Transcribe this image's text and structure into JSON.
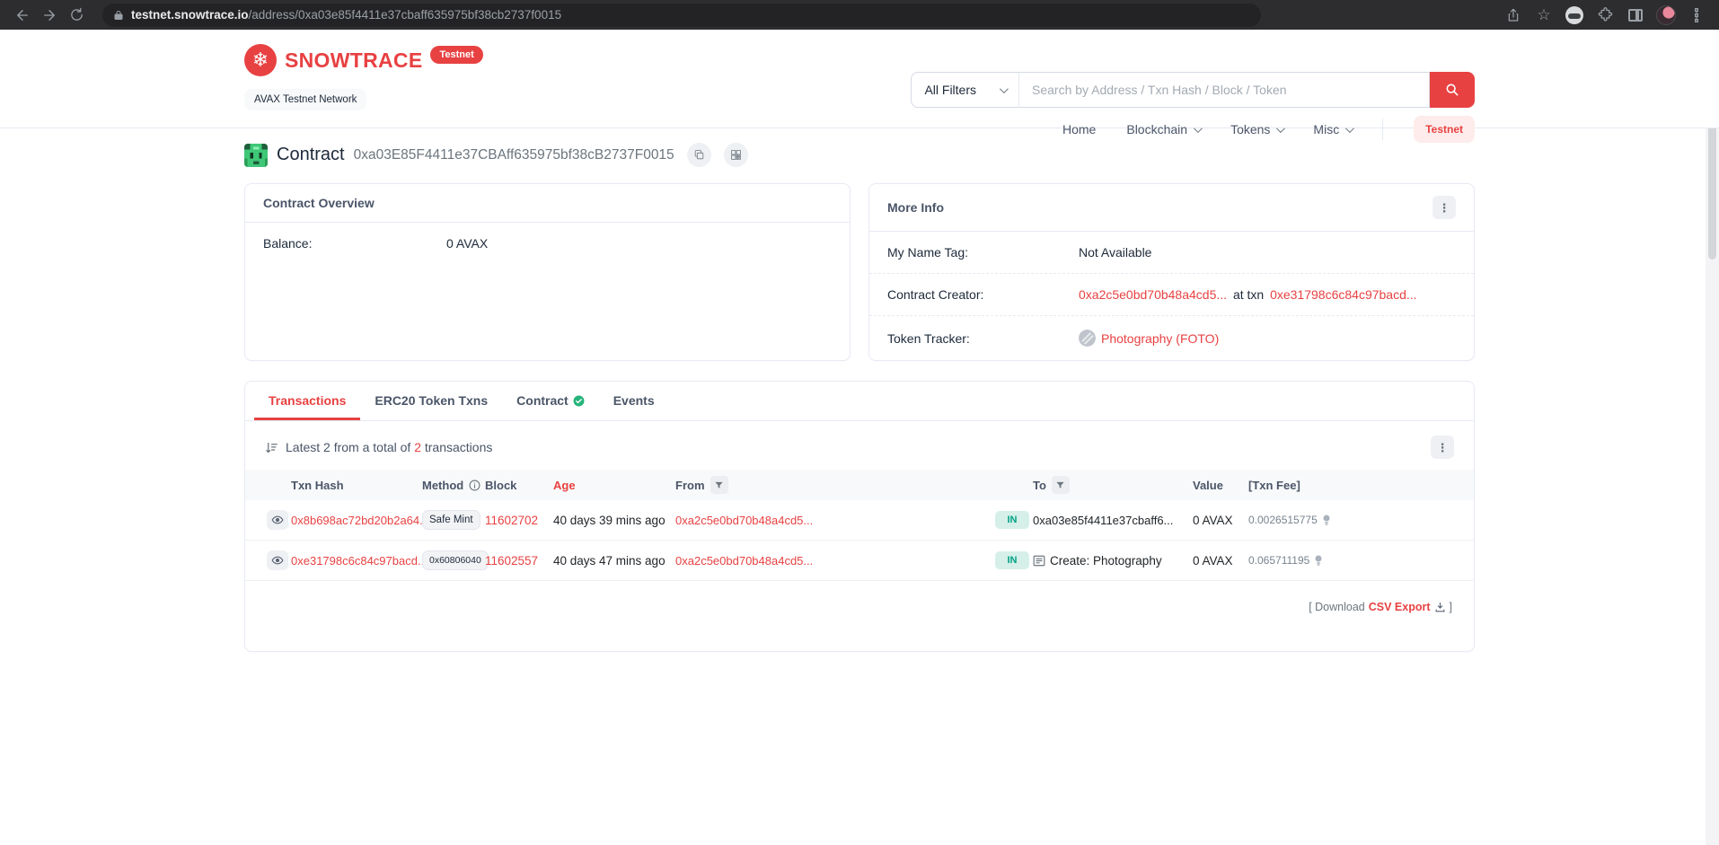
{
  "browser": {
    "url_domain": "testnet.snowtrace.io",
    "url_path": "/address/0xa03e85f4411e37cbaff635975bf38cb2737f0015"
  },
  "header": {
    "brand": "SNOWTRACE",
    "brand_badge": "Testnet",
    "network_label": "AVAX Testnet Network",
    "search": {
      "filter_label": "All Filters",
      "placeholder": "Search by Address / Txn Hash / Block / Token"
    },
    "nav": [
      {
        "label": "Home"
      },
      {
        "label": "Blockchain"
      },
      {
        "label": "Tokens"
      },
      {
        "label": "Misc"
      }
    ],
    "testnet_button": "Testnet"
  },
  "page": {
    "type_label": "Contract",
    "address": "0xa03E85F4411e37CBAff635975bf38cB2737F0015"
  },
  "overview_card": {
    "title": "Contract Overview",
    "balance_label": "Balance:",
    "balance_value": "0 AVAX"
  },
  "more_info_card": {
    "title": "More Info",
    "name_tag_label": "My Name Tag:",
    "name_tag_value": "Not Available",
    "creator_label": "Contract Creator:",
    "creator_address": "0xa2c5e0bd70b48a4cd5...",
    "creator_middle": "at txn",
    "creator_txn": "0xe31798c6c84c97bacd...",
    "tracker_label": "Token Tracker:",
    "tracker_value": "Photography (FOTO)"
  },
  "tabs": [
    {
      "label": "Transactions"
    },
    {
      "label": "ERC20 Token Txns"
    },
    {
      "label": "Contract"
    },
    {
      "label": "Events"
    }
  ],
  "transactions": {
    "summary_prefix": "Latest 2 from a total of",
    "summary_count": "2",
    "summary_suffix": "transactions",
    "columns": [
      "Txn Hash",
      "Method",
      "Block",
      "Age",
      "From",
      "To",
      "Value",
      "[Txn Fee]"
    ],
    "rows": [
      {
        "hash": "0x8b698ac72bd20b2a64...",
        "method": "Safe Mint",
        "block": "11602702",
        "age": "40 days 39 mins ago",
        "from": "0xa2c5e0bd70b48a4cd5...",
        "direction": "IN",
        "to": "0xa03e85f4411e37cbaff6...",
        "value": "0 AVAX",
        "fee": "0.0026515775"
      },
      {
        "hash": "0xe31798c6c84c97bacd...",
        "method": "0x60806040",
        "block": "11602557",
        "age": "40 days 47 mins ago",
        "from": "0xa2c5e0bd70b48a4cd5...",
        "direction": "IN",
        "to": "Create: Photography",
        "value": "0 AVAX",
        "fee": "0.065711195"
      }
    ],
    "download_prefix": "[ Download",
    "download_link": "CSV Export",
    "download_suffix": "]"
  },
  "colors": {
    "accent_red": "#e84142",
    "in_badge_text": "#00a186",
    "in_badge_bg": "#d6f0e9",
    "border": "#e7eaf3"
  }
}
